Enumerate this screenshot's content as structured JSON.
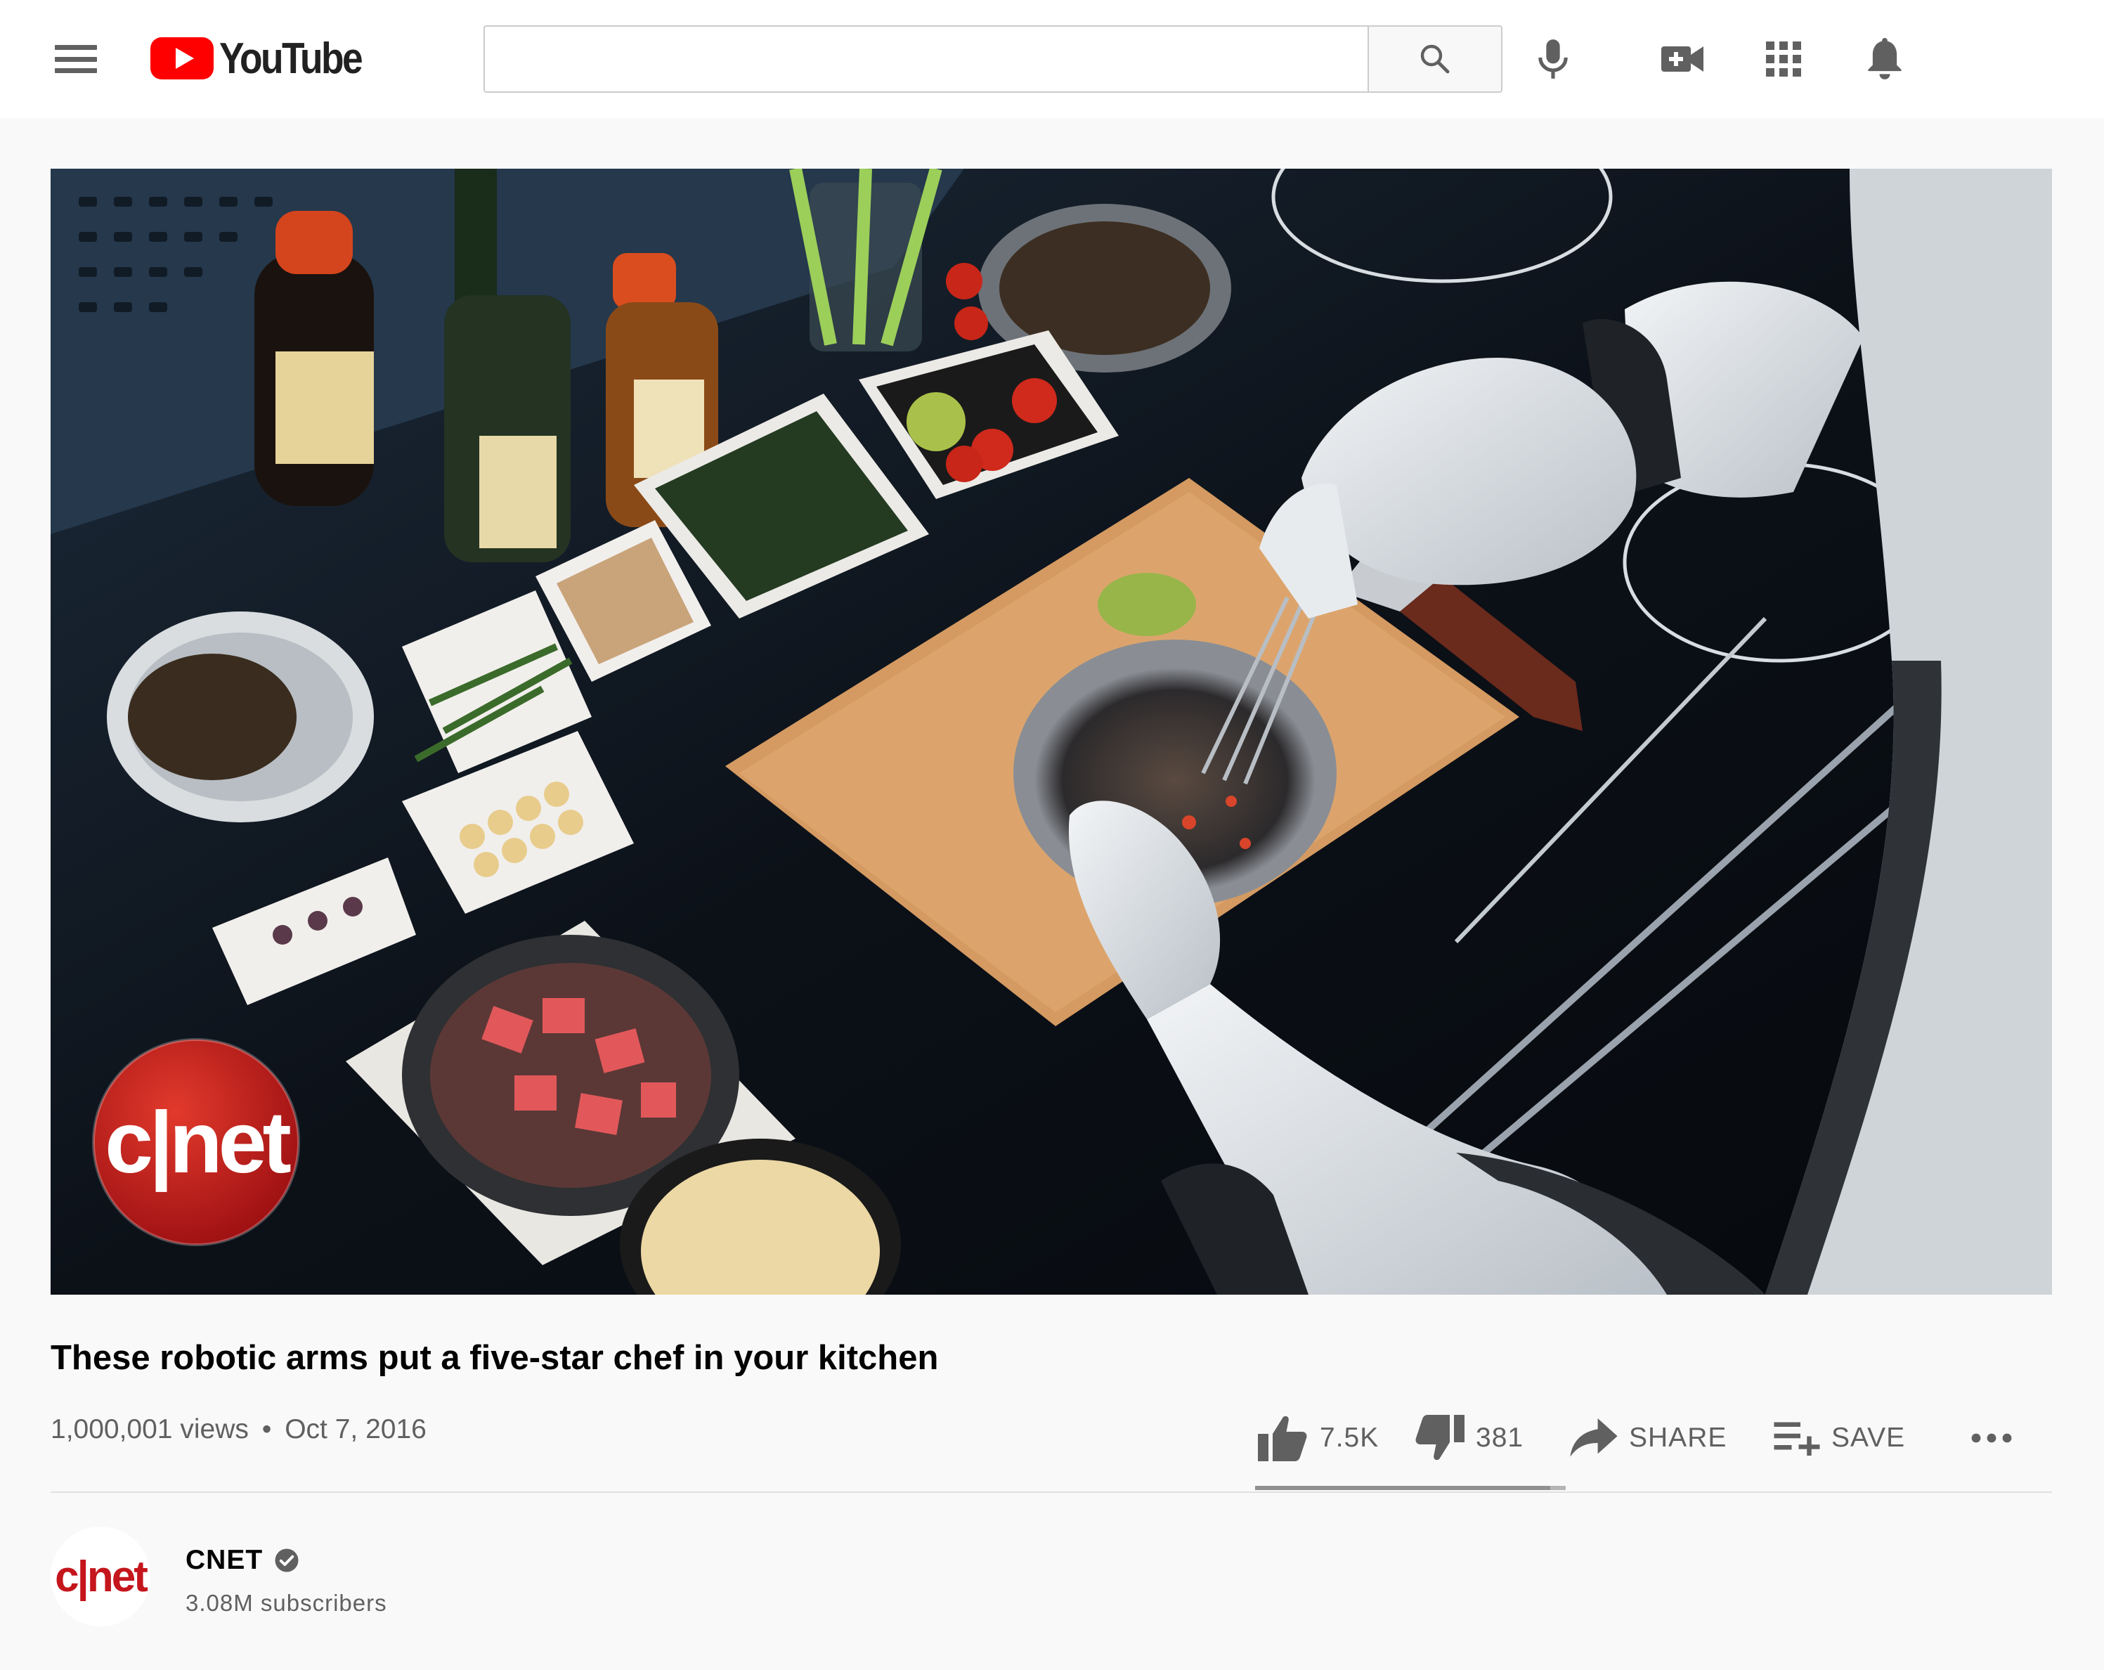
{
  "masthead": {
    "logo_text": "YouTube",
    "search_placeholder": "",
    "icons": [
      "menu-icon",
      "search-icon",
      "mic-icon",
      "video-create-icon",
      "apps-grid-icon",
      "bell-icon"
    ]
  },
  "video": {
    "overlay_logo": "c|net",
    "title": "These robotic arms put a five-star chef in your kitchen",
    "views": "1,000,001 views",
    "separator": "•",
    "date": "Oct 7, 2016",
    "likes": "7.5K",
    "dislikes": "381",
    "share_label": "SHARE",
    "save_label": "SAVE",
    "like_ratio": 0.95
  },
  "channel": {
    "avatar_text": "c|net",
    "name": "CNET",
    "subscribers": "3.08M subscribers",
    "verified": true
  },
  "colors": {
    "brand_red": "#ff0000",
    "cnet_red": "#c4161c",
    "text_primary": "#030303",
    "text_secondary": "#606060",
    "background": "#f9f9f9"
  }
}
